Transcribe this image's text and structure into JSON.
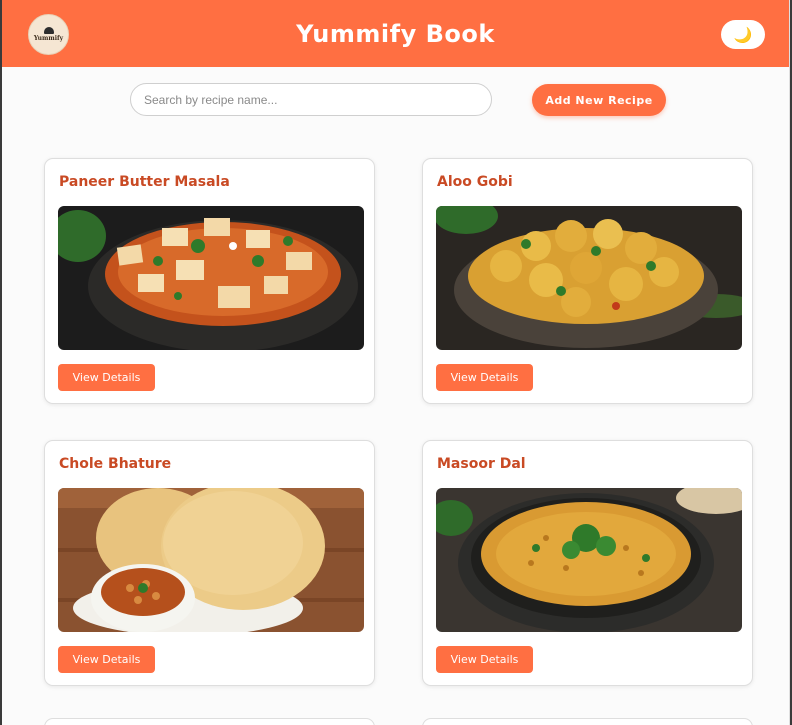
{
  "header": {
    "logo_text": "Yummify",
    "title": "Yummify Book",
    "theme_toggle_icon": "🌙"
  },
  "toolbar": {
    "search_placeholder": "Search by recipe name...",
    "add_label": "Add New Recipe"
  },
  "colors": {
    "brand": "#ff6f42",
    "card_title": "#c94a24"
  },
  "recipes": [
    {
      "title": "Paneer Butter Masala",
      "button": "View Details"
    },
    {
      "title": "Aloo Gobi",
      "button": "View Details"
    },
    {
      "title": "Chole Bhature",
      "button": "View Details"
    },
    {
      "title": "Masoor Dal",
      "button": "View Details"
    }
  ]
}
